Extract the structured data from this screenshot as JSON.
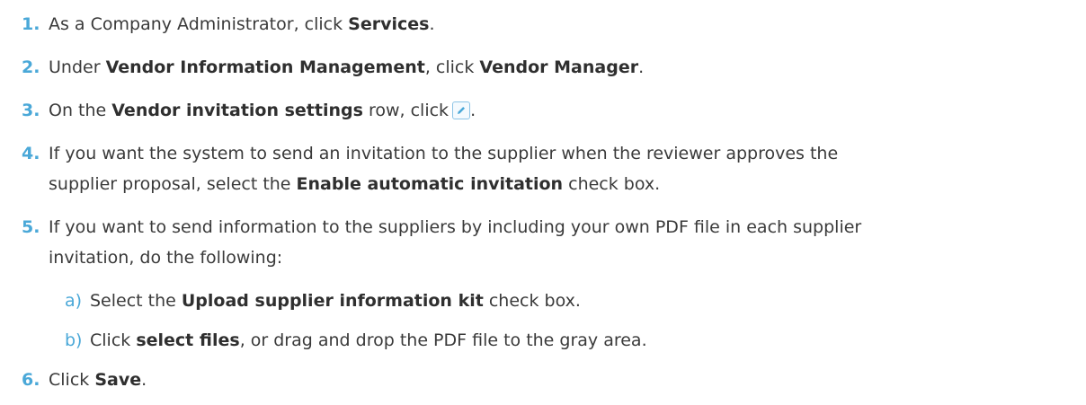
{
  "steps": [
    {
      "number": "1.",
      "parts": [
        "As a Company Administrator, click ",
        "Services",
        "."
      ]
    },
    {
      "number": "2.",
      "parts": [
        "Under ",
        "Vendor Information Management",
        ", click ",
        "Vendor Manager",
        "."
      ]
    },
    {
      "number": "3.",
      "parts": [
        "On the ",
        "Vendor invitation settings",
        " row, click",
        "."
      ]
    },
    {
      "number": "4.",
      "line1": "If you want the system to send an invitation to the supplier when the reviewer approves the",
      "line2_parts": [
        "supplier proposal, select the ",
        "Enable automatic invitation",
        " check box."
      ]
    },
    {
      "number": "5.",
      "line1": "If you want to send information to the suppliers by including your own PDF file in each supplier",
      "line2": "invitation, do the following:",
      "substeps": [
        {
          "letter": "a)",
          "parts": [
            "Select the ",
            "Upload supplier information kit",
            " check box."
          ]
        },
        {
          "letter": "b)",
          "parts": [
            "Click ",
            "select files",
            ", or drag and drop the PDF file to the gray area."
          ]
        }
      ]
    },
    {
      "number": "6.",
      "parts": [
        "Click ",
        "Save",
        "."
      ]
    }
  ],
  "icons": {
    "edit": "pencil-edit-icon"
  },
  "colors": {
    "number": "#4aa8d8",
    "text": "#3a3a3a"
  }
}
